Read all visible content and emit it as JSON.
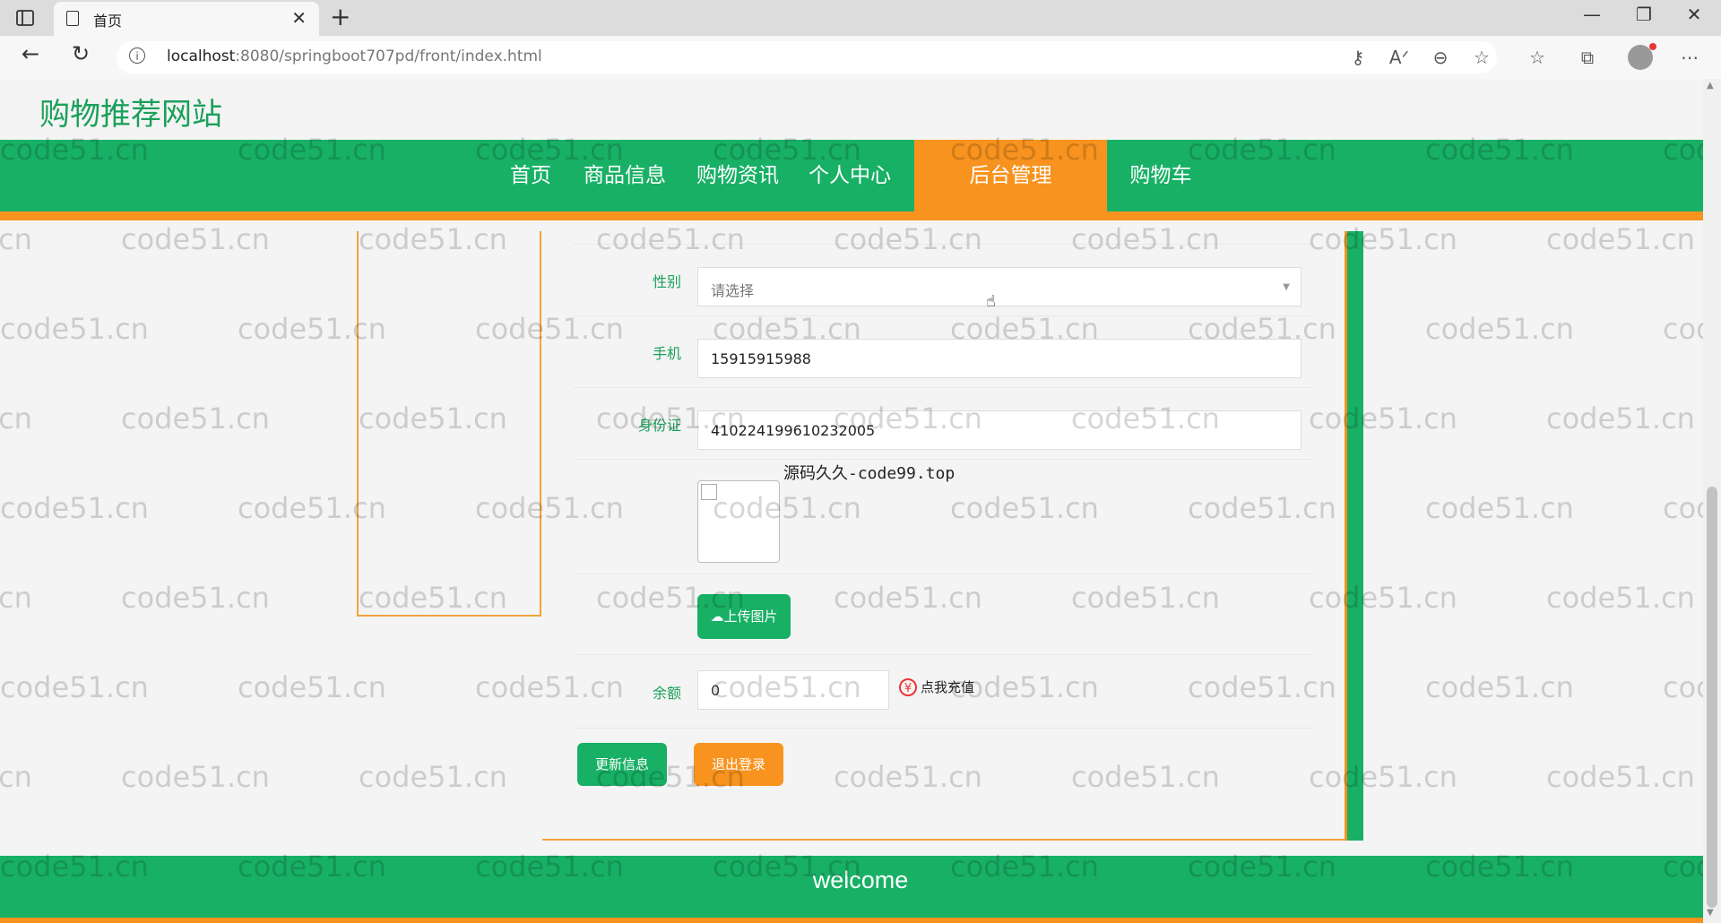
{
  "browser": {
    "tab_title": "首页",
    "url_host": "localhost",
    "url_rest": ":8080/springboot707pd/front/index.html"
  },
  "site": {
    "title": "购物推荐网站"
  },
  "nav": {
    "items": [
      {
        "label": "首页"
      },
      {
        "label": "商品信息"
      },
      {
        "label": "购物资讯"
      },
      {
        "label": "个人中心"
      },
      {
        "label": "后台管理",
        "active": true
      },
      {
        "label": "购物车"
      }
    ]
  },
  "form": {
    "gender_label": "性别",
    "gender_placeholder": "请选择",
    "phone_label": "手机",
    "phone_value": "15915915988",
    "idcard_label": "身份证",
    "idcard_value": "410224199610232005",
    "image_caption": "源码久久-code99.top",
    "upload_label": "上传图片",
    "balance_label": "余额",
    "balance_value": "0",
    "recharge_label": "点我充值",
    "update_button": "更新信息",
    "logout_button": "退出登录"
  },
  "footer": {
    "text": "welcome"
  },
  "watermark": "code51.cn",
  "colors": {
    "green": "#18b065",
    "orange": "#f7931e"
  }
}
